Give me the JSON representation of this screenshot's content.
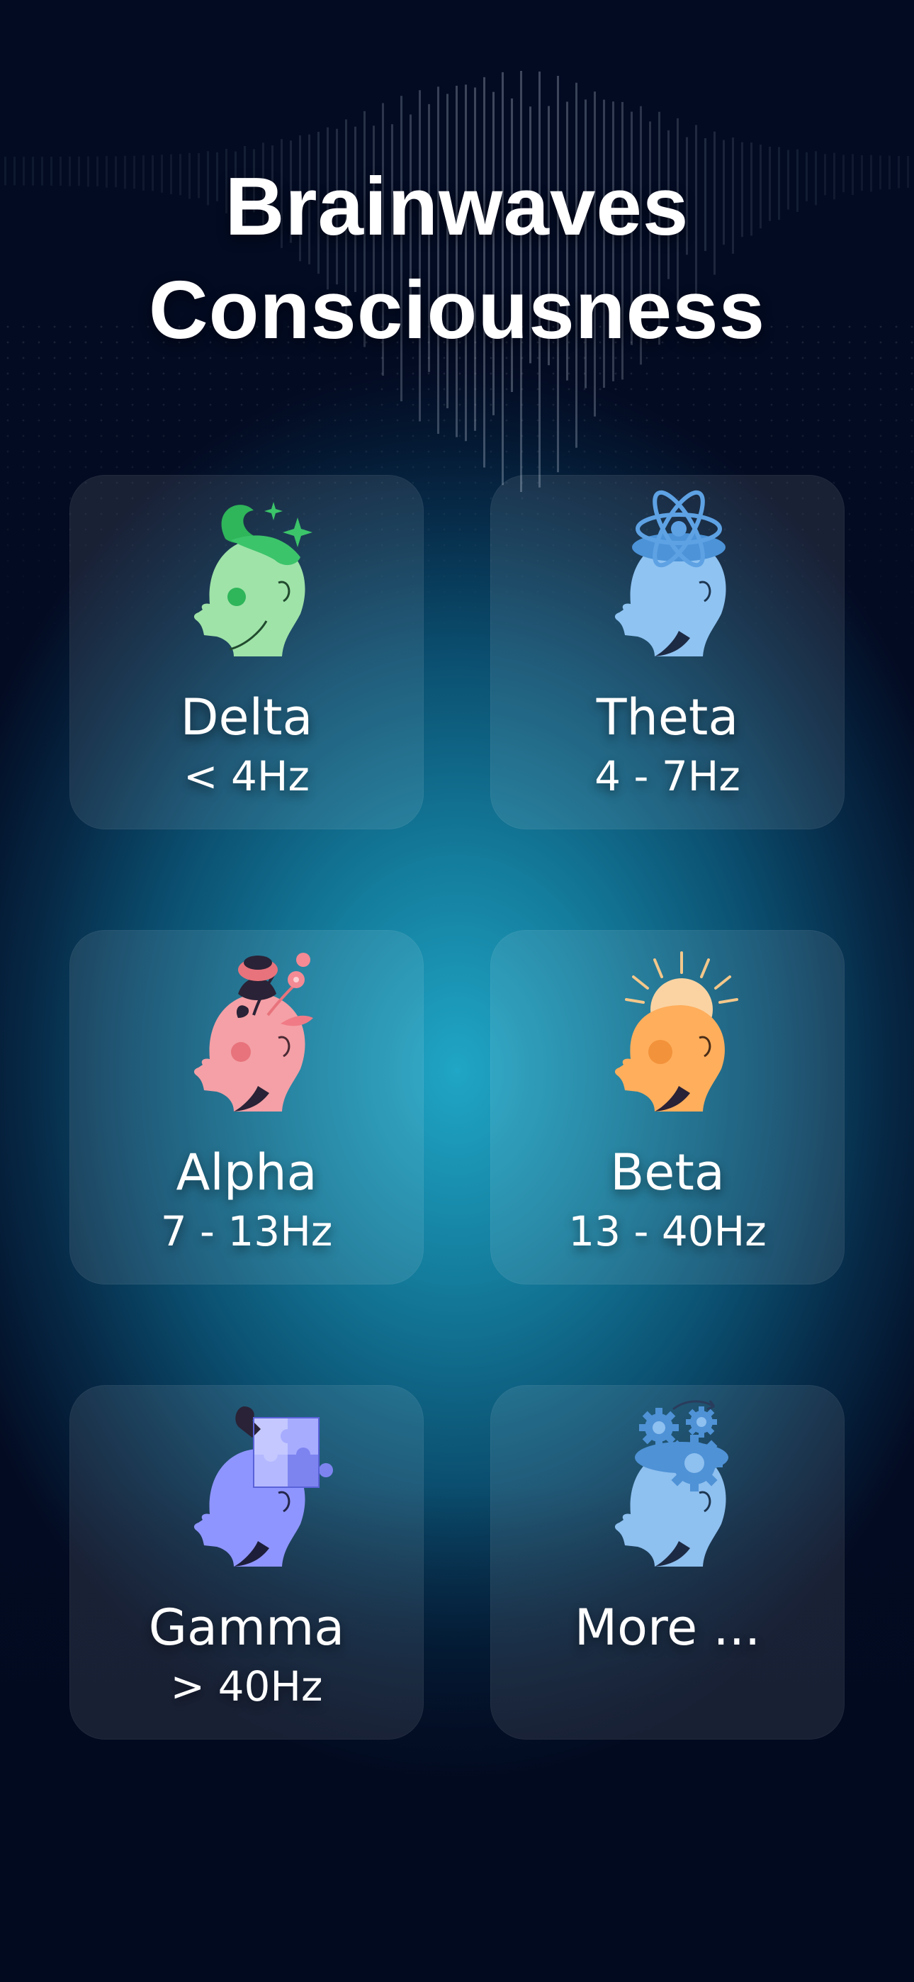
{
  "title": {
    "line1": "Brainwaves",
    "line2": "Consciousness"
  },
  "cards": [
    {
      "name": "Delta",
      "range": "< 4Hz",
      "icon": "head-moon-sparkle-icon",
      "color": "#8fdd9c"
    },
    {
      "name": "Theta",
      "range": "4 - 7Hz",
      "icon": "head-atom-icon",
      "color": "#7fb8ef"
    },
    {
      "name": "Alpha",
      "range": "7 - 13Hz",
      "icon": "head-flowers-icon",
      "color": "#f49aa0"
    },
    {
      "name": "Beta",
      "range": "13 - 40Hz",
      "icon": "head-sun-icon",
      "color": "#ffae5c"
    },
    {
      "name": "Gamma",
      "range": "> 40Hz",
      "icon": "head-puzzle-icon",
      "color": "#8f95ff"
    },
    {
      "name": "More ...",
      "icon": "head-gears-icon",
      "color": "#82b9ee"
    }
  ]
}
